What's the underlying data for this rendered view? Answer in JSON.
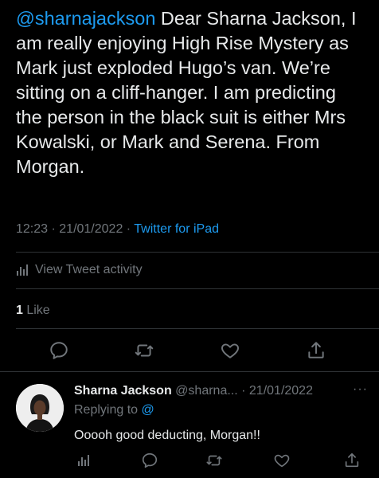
{
  "tweet": {
    "mention": "@sharnajackson",
    "text": " Dear Sharna Jackson, I am really enjoying High Rise Mystery as Mark just exploded Hugo’s van. We’re sitting on a cliff-hanger. I am predicting the person in the black suit is either Mrs Kowalski, or Mark and Serena. From Morgan.",
    "time": "12:23",
    "date": "21/01/2022",
    "source": "Twitter for iPad",
    "separator": " · "
  },
  "activity": {
    "icon": "analytics-icon",
    "label": "View Tweet activity"
  },
  "likes": {
    "count": "1",
    "label": " Like"
  },
  "actions": [
    "reply-icon",
    "retweet-icon",
    "like-icon",
    "share-icon"
  ],
  "reply": {
    "name": "Sharna Jackson",
    "handle": " @sharna... · 21/01/2022",
    "more": "···",
    "replying_label": "Replying to ",
    "replying_to": "@",
    "text": "Ooooh good deducting, Morgan!!"
  },
  "colors": {
    "background": "#000000",
    "text": "#e7e9ea",
    "muted": "#71767b",
    "accent": "#1d9bf0",
    "divider": "#2f3336"
  }
}
